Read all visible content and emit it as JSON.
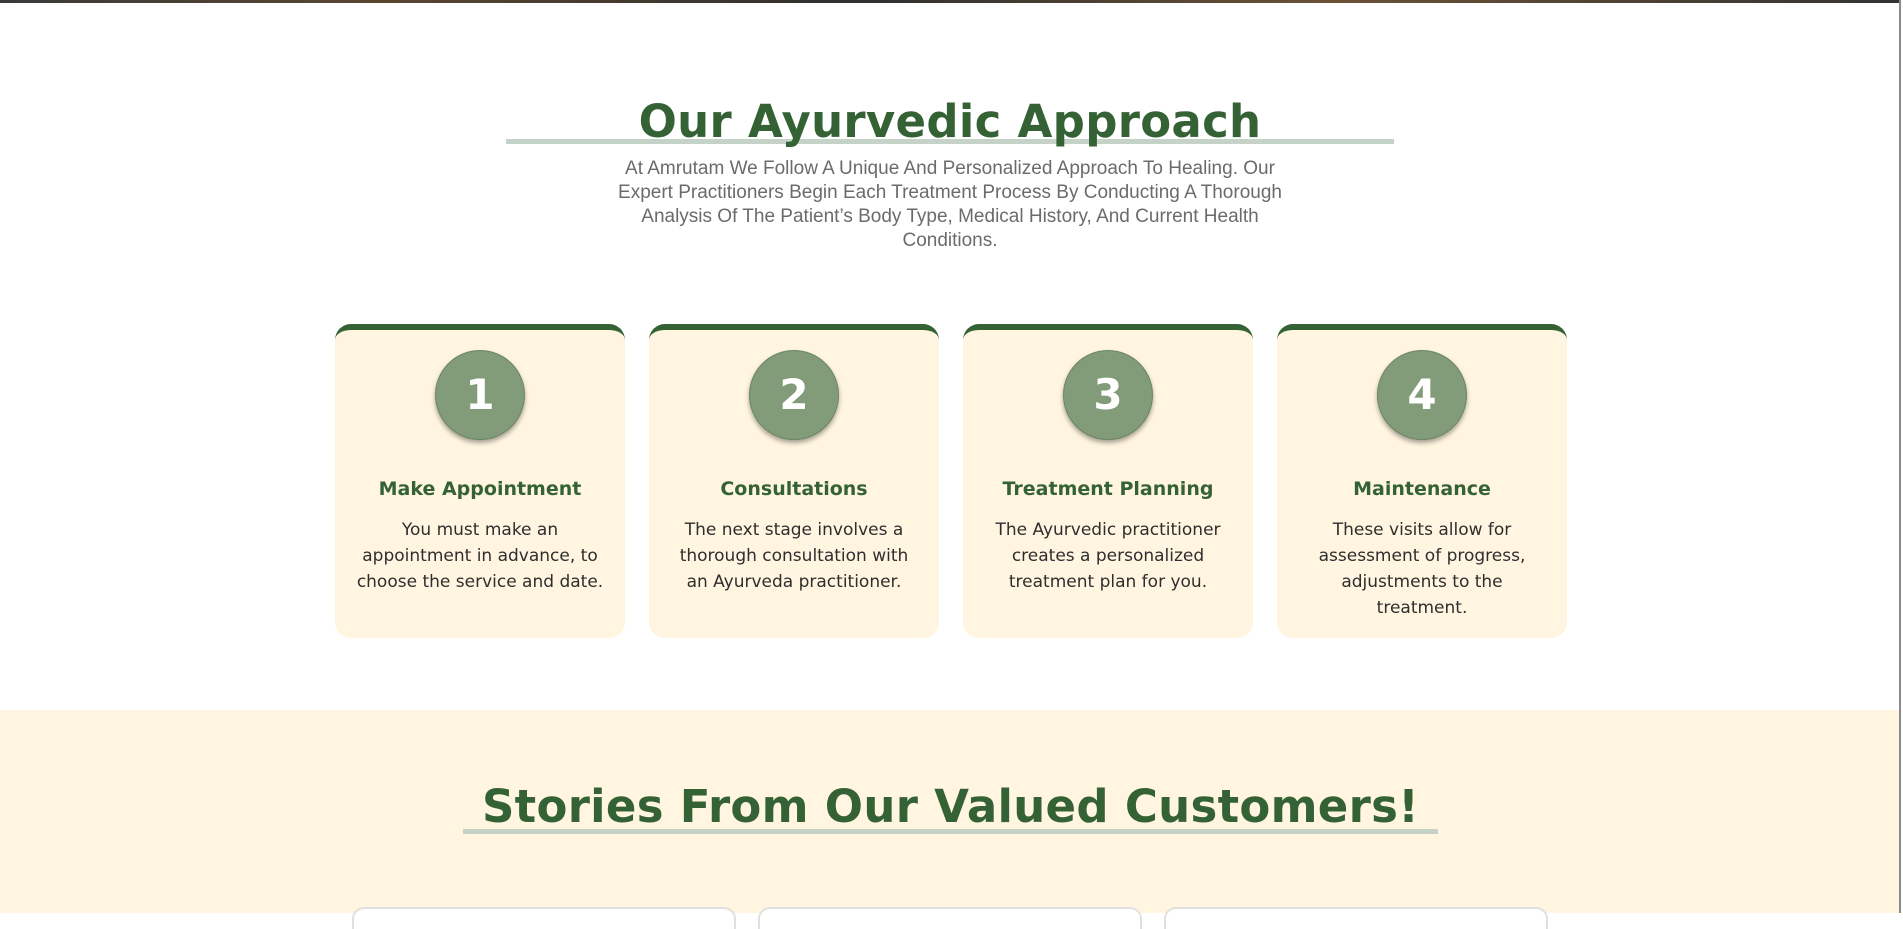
{
  "approach": {
    "heading": "Our Ayurvedic Approach",
    "subtitle": "At Amrutam We Follow A Unique And Personalized Approach To Healing. Our Expert Practitioners Begin Each Treatment Process By Conducting A Thorough Analysis Of The Patient’s Body Type, Medical History, And Current Health Conditions.",
    "steps": [
      {
        "number": "1",
        "title": "Make Appointment",
        "text": "You must make an appointment in advance, to choose the service and date."
      },
      {
        "number": "2",
        "title": "Consultations",
        "text": "The next stage involves a thorough consultation with an Ayurveda practitioner."
      },
      {
        "number": "3",
        "title": "Treatment Planning",
        "text": "The Ayurvedic practitioner creates a personalized treatment plan for you."
      },
      {
        "number": "4",
        "title": "Maintenance",
        "text": "These visits allow for assessment of progress, adjustments to the treatment."
      }
    ]
  },
  "stories": {
    "heading": "Stories From Our Valued Customers!"
  },
  "colors": {
    "brand_green": "#356235",
    "badge_green": "#829b78",
    "cream": "#fff5e0",
    "underline": "#c5d2c8"
  }
}
